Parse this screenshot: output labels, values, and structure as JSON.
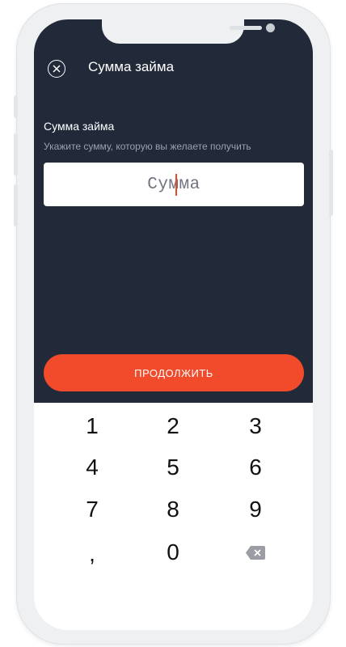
{
  "header": {
    "title": "Сумма займа"
  },
  "form": {
    "label": "Сумма займа",
    "hint": "Укажите сумму, которую вы желаете получить",
    "amount_placeholder": "Сумма",
    "continue_label": "ПРОДОЛЖИТЬ"
  },
  "keypad": {
    "keys": [
      "1",
      "2",
      "3",
      "4",
      "5",
      "6",
      "7",
      "8",
      "9",
      ",",
      "0"
    ],
    "backspace_icon": "backspace-icon"
  },
  "colors": {
    "screen_background": "#222a3a",
    "accent": "#f24b2c",
    "caret": "#ea4a2b"
  }
}
